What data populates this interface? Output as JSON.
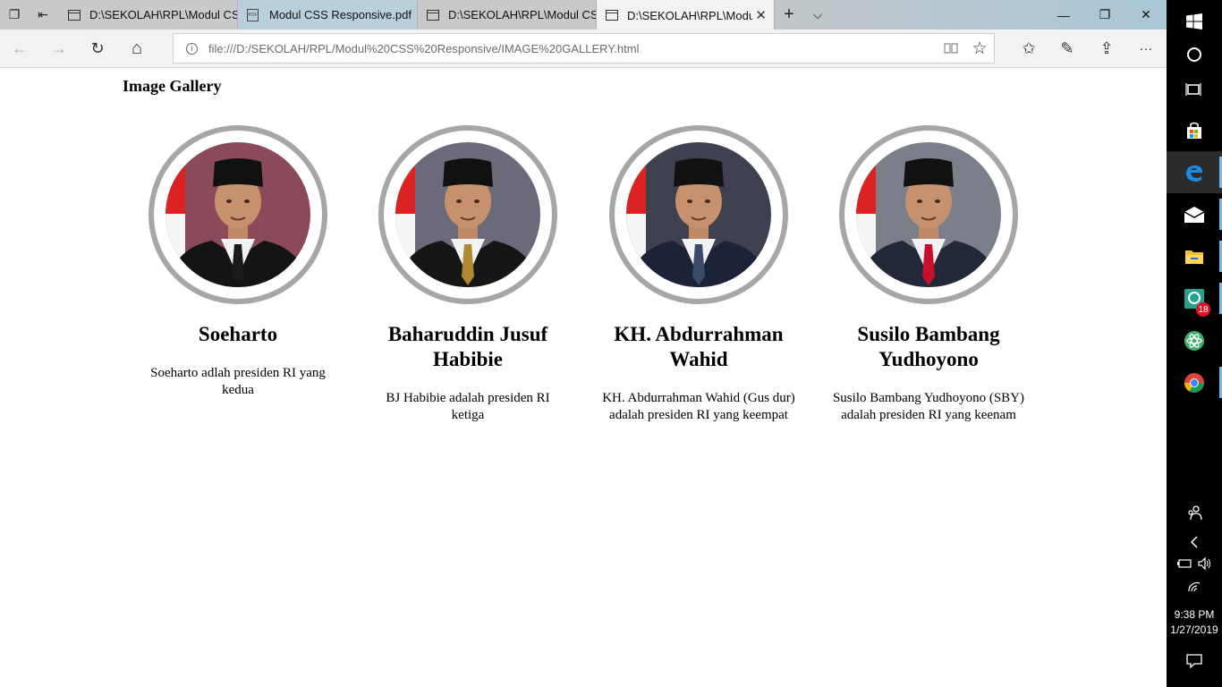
{
  "browser": {
    "tabs": [
      {
        "label": "D:\\SEKOLAH\\RPL\\Modul CS",
        "icon": "page-icon",
        "active": false
      },
      {
        "label": "Modul CSS Responsive.pdf",
        "icon": "pdf-icon",
        "active": false
      },
      {
        "label": "D:\\SEKOLAH\\RPL\\Modul CS",
        "icon": "page-icon",
        "active": false
      },
      {
        "label": "D:\\SEKOLAH\\RPL\\Modu",
        "icon": "page-icon",
        "active": true
      }
    ],
    "new_tab_glyph": "+",
    "tab_list_glyph": "⌵",
    "close_tab_glyph": "✕",
    "pdf_icon_text": "PDF",
    "address_url": "file:///D:/SEKOLAH/RPL/Modul%20CSS%20Responsive/IMAGE%20GALLERY.html",
    "info_glyph": "i",
    "nav": {
      "back": "←",
      "forward": "→",
      "refresh": "↻",
      "home": "⌂",
      "reading_view": "📖",
      "favorite": "☆",
      "favorites_hub": "✩",
      "notes": "✎",
      "share": "⇪",
      "more": "···"
    },
    "window": {
      "minimize": "—",
      "restore": "❐",
      "close": "✕"
    }
  },
  "page": {
    "title": "Image Gallery",
    "cards": [
      {
        "name": "Soeharto",
        "description": "Soeharto adlah presiden RI yang kedua",
        "tie_color": "#1a1a1a",
        "suit_color": "#141414",
        "bg_color": "#8a4a5a"
      },
      {
        "name": "Baharuddin Jusuf Habibie",
        "description": "BJ Habibie adalah presiden RI ketiga",
        "tie_color": "#b08a30",
        "suit_color": "#161616",
        "bg_color": "#6a6a7a"
      },
      {
        "name": "KH. Abdurrahman Wahid",
        "description": "KH. Abdurrahman Wahid (Gus dur) adalah presiden RI yang keempat",
        "tie_color": "#3a4a6a",
        "suit_color": "#1c2338",
        "bg_color": "#3f4050"
      },
      {
        "name": "Susilo Bambang Yudhoyono",
        "description": "Susilo Bambang Yudhoyono (SBY) adalah presiden RI yang keenam",
        "tie_color": "#c8102e",
        "suit_color": "#232838",
        "bg_color": "#7a7f8a"
      }
    ]
  },
  "taskbar": {
    "start_icon": "windows-logo-icon",
    "badge_count": "18",
    "time": "9:38 PM",
    "date": "1/27/2019",
    "colors": {
      "accent": "#76b9ed",
      "background": "#000000"
    }
  }
}
